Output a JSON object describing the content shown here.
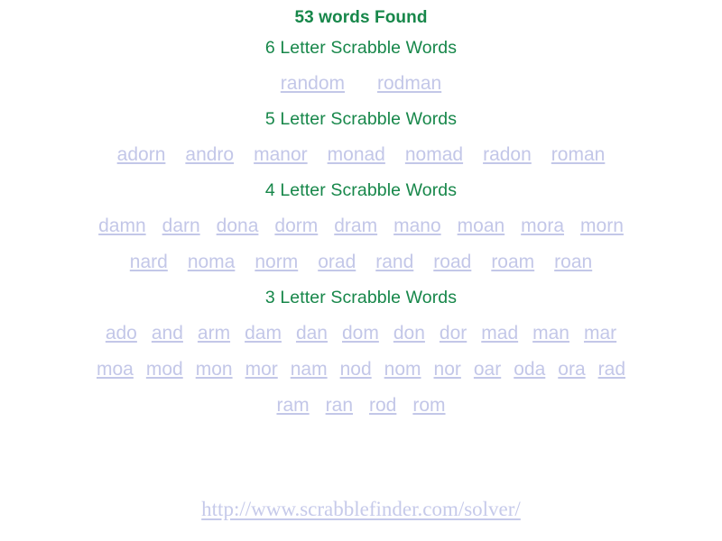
{
  "colors": {
    "heading_green": "#17874a",
    "link_lavender": "#c3c7e8",
    "footer_link": "#c6caea",
    "background": "#ffffff"
  },
  "results": {
    "found_title": "53 words Found",
    "total_count": 53
  },
  "sections": [
    {
      "heading": "6 Letter Scrabble Words",
      "letter_count": 6,
      "word_count": 2,
      "rows": [
        [
          "random",
          "rodman"
        ]
      ]
    },
    {
      "heading": "5 Letter Scrabble Words",
      "letter_count": 5,
      "word_count": 7,
      "rows": [
        [
          "adorn",
          "andro",
          "manor",
          "monad",
          "nomad",
          "radon",
          "roman"
        ]
      ]
    },
    {
      "heading": "4 Letter Scrabble Words",
      "letter_count": 4,
      "word_count": 17,
      "rows": [
        [
          "damn",
          "darn",
          "dona",
          "dorm",
          "dram",
          "mano",
          "moan",
          "mora",
          "morn"
        ],
        [
          "nard",
          "noma",
          "norm",
          "orad",
          "rand",
          "road",
          "roam",
          "roan"
        ]
      ]
    },
    {
      "heading": "3 Letter Scrabble Words",
      "letter_count": 3,
      "word_count": 27,
      "rows": [
        [
          "ado",
          "and",
          "arm",
          "dam",
          "dan",
          "dom",
          "don",
          "dor",
          "mad",
          "man",
          "mar"
        ],
        [
          "moa",
          "mod",
          "mon",
          "mor",
          "nam",
          "nod",
          "nom",
          "nor",
          "oar",
          "oda",
          "ora",
          "rad"
        ],
        [
          "ram",
          "ran",
          "rod",
          "rom"
        ]
      ]
    }
  ],
  "footer": {
    "url_label": "http://www.scrabblefinder.com/solver/"
  }
}
